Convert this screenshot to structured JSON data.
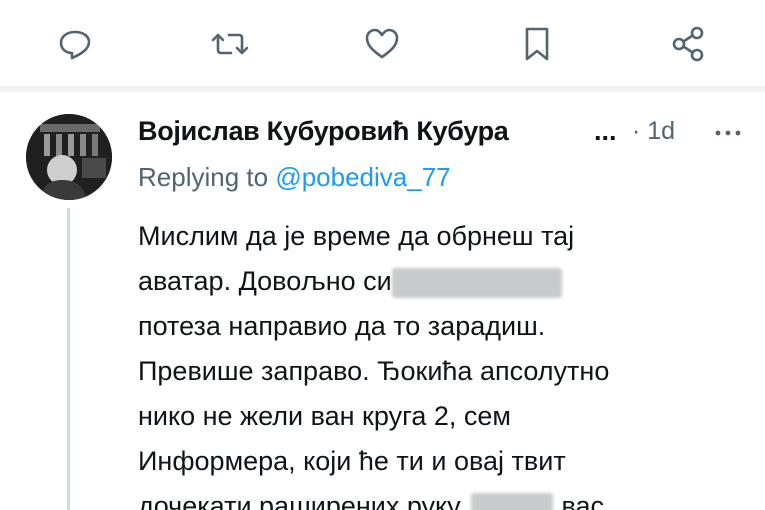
{
  "actions": {
    "reply_icon": "reply-icon",
    "retweet_icon": "retweet-icon",
    "like_icon": "like-icon",
    "bookmark_icon": "bookmark-icon",
    "share_icon": "share-icon"
  },
  "tweet": {
    "author_name": "Војислав Кубуровић Кубура",
    "name_truncation": "...",
    "time": "· 1d",
    "replying_prefix": "Replying to ",
    "replying_handle": "@pobediva_77",
    "lines": [
      "Мислим да је време да обрнеш тај",
      "аватар. Довољно си",
      "потеза направио да то зарадиш.",
      "Превише заправо. Ђокића апсолутно",
      "нико не жели ван круга 2, сем",
      "Информера, који ће ти и овај твит",
      "дочекати раширених руку,"
    ],
    "line7_tail": "вас"
  },
  "colors": {
    "text_primary": "#0f1419",
    "text_secondary": "#536471",
    "link": "#1d9bf0",
    "divider": "#eff3f4"
  }
}
